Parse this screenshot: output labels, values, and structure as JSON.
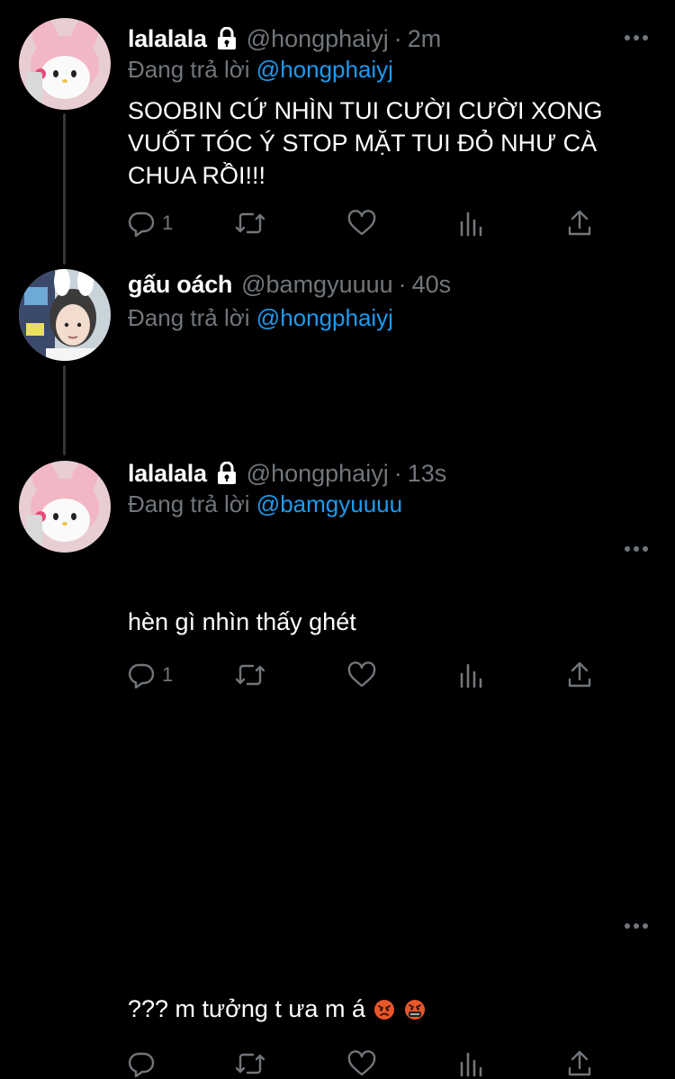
{
  "thread": [
    {
      "display_name": "lalalala",
      "protected": true,
      "handle": "@hongphaiyj",
      "separator": "·",
      "time": "2m",
      "reply_prefix": "Đang trả lời",
      "reply_to": "@hongphaiyj",
      "text": "SOOBIN CỨ NHÌN TUI CƯỜI CƯỜI XONG VUỐT TÓC Ý STOP MẶT TUI ĐỎ NHƯ CÀ CHUA RỒI!!!",
      "reply_count": "1",
      "avatar": "pink-bunny-plush-avatar"
    },
    {
      "display_name": "gấu oách",
      "protected": false,
      "handle": "@bamgyuuuu",
      "separator": "·",
      "time": "40s",
      "reply_prefix": "Đang trả lời",
      "reply_to": "@hongphaiyj",
      "text": "hèn gì nhìn thấy ghét",
      "reply_count": "1",
      "avatar": "person-with-bunny-headband-avatar"
    },
    {
      "display_name": "lalalala",
      "protected": true,
      "handle": "@hongphaiyj",
      "separator": "·",
      "time": "13s",
      "reply_prefix": "Đang trả lời",
      "reply_to": "@bamgyuuuu",
      "text": "??? m tưởng t ưa m á",
      "emojis": [
        "angry-face-emoji",
        "cursing-face-emoji"
      ],
      "reply_count": "",
      "avatar": "pink-bunny-plush-avatar"
    }
  ],
  "colors": {
    "background": "#000000",
    "text": "#ffffff",
    "secondary": "#71767b",
    "mention": "#1d9bf0",
    "thread_line": "#333639"
  },
  "icons": [
    "lock-icon",
    "more-icon",
    "reply-icon",
    "retweet-icon",
    "like-icon",
    "views-icon",
    "share-icon"
  ]
}
